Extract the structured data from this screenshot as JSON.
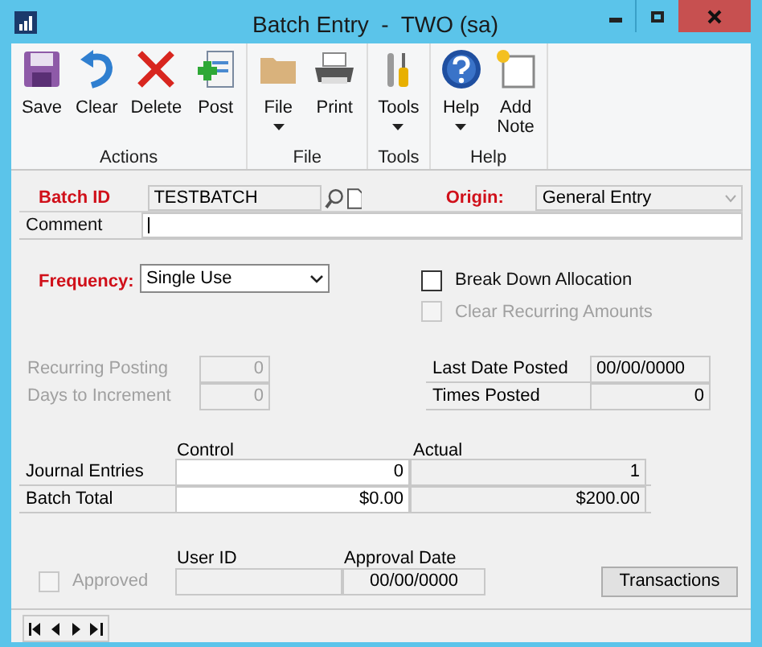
{
  "window": {
    "title": "Batch Entry  -  TWO (sa)"
  },
  "ribbon": {
    "groups": [
      {
        "label": "Actions",
        "buttons": [
          {
            "label": "Save",
            "kind": "save",
            "dropdown": false
          },
          {
            "label": "Clear",
            "kind": "clear",
            "dropdown": false
          },
          {
            "label": "Delete",
            "kind": "delete",
            "dropdown": false
          },
          {
            "label": "Post",
            "kind": "post",
            "dropdown": false
          }
        ]
      },
      {
        "label": "File",
        "buttons": [
          {
            "label": "File",
            "kind": "file",
            "dropdown": true
          },
          {
            "label": "Print",
            "kind": "print",
            "dropdown": false
          }
        ]
      },
      {
        "label": "Tools",
        "buttons": [
          {
            "label": "Tools",
            "kind": "tools",
            "dropdown": true
          }
        ]
      },
      {
        "label": "Help",
        "buttons": [
          {
            "label": "Help",
            "kind": "help",
            "dropdown": true
          },
          {
            "label": "Add Note",
            "kind": "note",
            "dropdown": false
          }
        ]
      }
    ]
  },
  "batch_id": {
    "label": "Batch ID",
    "required": true,
    "value": "TESTBATCH"
  },
  "origin": {
    "label": "Origin:",
    "required": true,
    "value": "General Entry",
    "disabled": true
  },
  "comment": {
    "label": "Comment",
    "focused": true
  },
  "frequency": {
    "label": "Frequency:",
    "required": true,
    "value": "Single Use"
  },
  "checkboxes": [
    {
      "label": "Break Down Allocation",
      "checked": false,
      "disabled": false
    },
    {
      "label": "Clear Recurring Amounts",
      "checked": false,
      "disabled": true
    }
  ],
  "recurring": [
    {
      "label": "Recurring Posting",
      "value": "0",
      "disabled": true
    },
    {
      "label": "Days to Increment",
      "value": "0",
      "disabled": true
    }
  ],
  "posting_info": [
    {
      "label": "Last Date Posted",
      "value": "00/00/0000"
    },
    {
      "label": "Times Posted",
      "value": "0"
    }
  ],
  "totals": {
    "columns": [
      "Control",
      "Actual"
    ],
    "rows": [
      {
        "label": "Journal Entries",
        "control": "0",
        "actual": "1"
      },
      {
        "label": "Batch Total",
        "control": "$0.00",
        "actual": "$200.00"
      }
    ]
  },
  "approval": {
    "checkbox": {
      "label": "Approved",
      "checked": false,
      "disabled": true
    },
    "user_id_label": "User ID",
    "date_label": "Approval Date",
    "date": "00/00/0000"
  },
  "transactions_button": "Transactions"
}
